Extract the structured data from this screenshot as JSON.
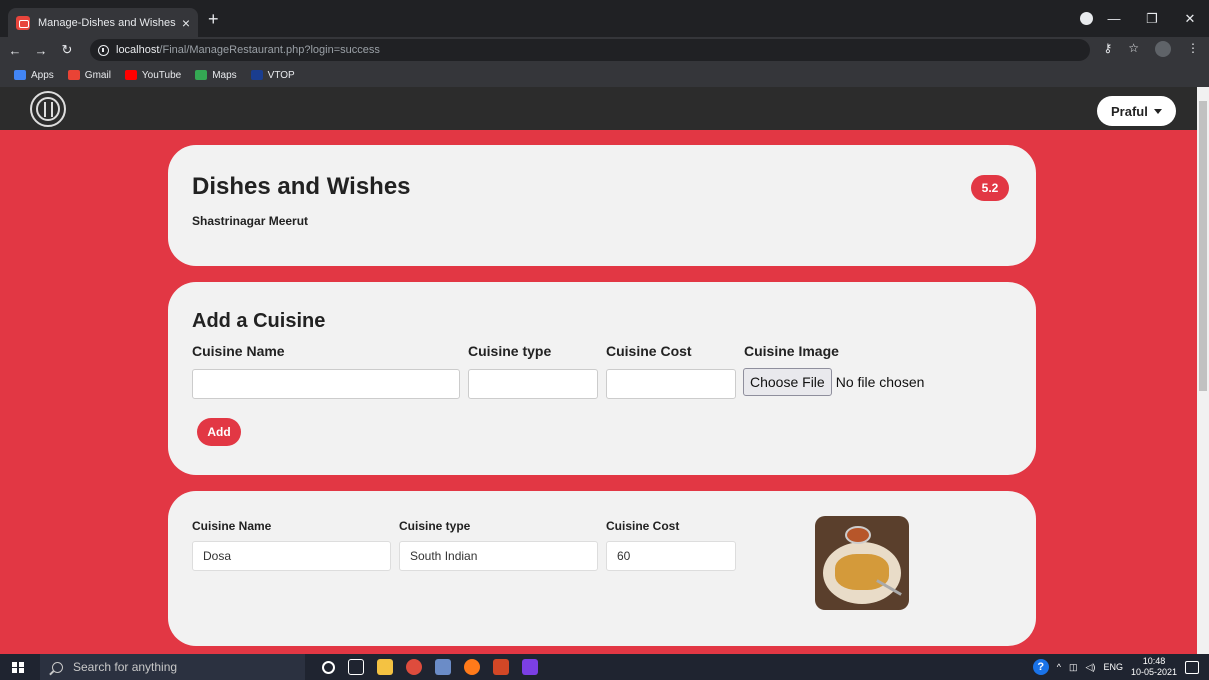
{
  "browser": {
    "tab_title": "Manage-Dishes and Wishes",
    "tab_close": "×",
    "new_tab": "+",
    "url_host": "localhost",
    "url_path": "/Final/ManageRestaurant.php?login=success",
    "bookmarks": [
      "Apps",
      "Gmail",
      "YouTube",
      "Maps",
      "VTOP"
    ],
    "bookmark_colors": [
      "#4285f4",
      "#ea4335",
      "#ff0000",
      "#34a853",
      "#1a3d8f"
    ]
  },
  "navbar": {
    "user_label": "Praful"
  },
  "restaurant": {
    "name": "Dishes and Wishes",
    "address": "Shastrinagar Meerut",
    "rating": "5.2"
  },
  "add_form": {
    "title": "Add a Cuisine",
    "name_label": "Cuisine Name",
    "type_label": "Cuisine type",
    "cost_label": "Cuisine Cost",
    "image_label": "Cuisine Image",
    "choose_file_label": "Choose File",
    "file_status": "No file chosen",
    "add_label": "Add"
  },
  "cuisine_item": {
    "name_label": "Cuisine Name",
    "type_label": "Cuisine type",
    "cost_label": "Cuisine Cost",
    "name": "Dosa",
    "type": "South Indian",
    "cost": "60"
  },
  "taskbar": {
    "search_placeholder": "Search for anything",
    "language": "ENG",
    "time": "10:48",
    "date": "10-05-2021"
  },
  "colors": {
    "accent": "#e23744",
    "card": "#f2f2f2",
    "navbar": "#2c2c2c"
  }
}
